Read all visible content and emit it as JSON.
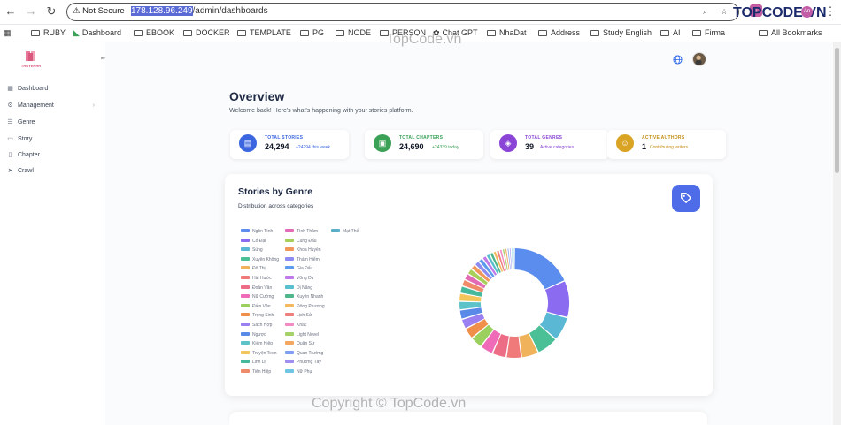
{
  "browser": {
    "security_label": "Not Secure",
    "url_host": "178.128.96.249",
    "url_path": "/admin/dashboards",
    "brand_logo": "TOPCODE.VN",
    "profile_initials": "An",
    "bookmarks": [
      "RUBY",
      "Dashboard",
      "EBOOK",
      "DOCKER",
      "TEMPLATE",
      "PG",
      "NODE",
      "PERSON",
      "Chat GPT",
      "NhaDat",
      "Address",
      "Study English",
      "AI",
      "Firma"
    ],
    "all_bookmarks": "All Bookmarks"
  },
  "sidebar": {
    "brand": "TRUYENHH",
    "items": [
      {
        "label": "Dashboard",
        "icon": "grid-icon"
      },
      {
        "label": "Management",
        "icon": "gear-icon"
      },
      {
        "label": "Genre",
        "icon": "list-icon"
      },
      {
        "label": "Story",
        "icon": "book-icon"
      },
      {
        "label": "Chapter",
        "icon": "document-icon"
      },
      {
        "label": "Crawl",
        "icon": "send-icon"
      }
    ]
  },
  "header": {
    "title": "Overview",
    "subtitle": "Welcome back! Here's what's happening with your stories platform."
  },
  "stats": [
    {
      "label": "TOTAL STORIES",
      "value": "24,294",
      "sub": "+24294 this week",
      "color": "#3b66e0",
      "label_color": "#3b66e0",
      "sub_color": "#3b66e0",
      "icon": "book-icon"
    },
    {
      "label": "TOTAL CHAPTERS",
      "value": "24,690",
      "sub": "+24339 today",
      "color": "#3aa157",
      "label_color": "#3aa157",
      "sub_color": "#3aa157",
      "icon": "document-icon"
    },
    {
      "label": "TOTAL GENRES",
      "value": "39",
      "sub": "Active categories",
      "color": "#8b45d6",
      "label_color": "#8b45d6",
      "sub_color": "#8b45d6",
      "icon": "layers-icon"
    },
    {
      "label": "ACTIVE AUTHORS",
      "value": "1",
      "sub": "Contributing writers",
      "color": "#d9a423",
      "label_color": "#c38d12",
      "sub_color": "#c38d12",
      "icon": "users-icon"
    }
  ],
  "genre_chart": {
    "title": "Stories by Genre",
    "subtitle": "Distribution across categories"
  },
  "chart_data": {
    "type": "pie",
    "title": "Stories by Genre",
    "subtitle": "Distribution across categories",
    "donut": true,
    "legend_position": "left",
    "categories": [
      "Ngôn Tình",
      "Cổ Đại",
      "Sủng",
      "Xuyên Không",
      "Đô Thị",
      "Hài Hước",
      "Đoản Văn",
      "Nữ Cường",
      "Điền Văn",
      "Trọng Sinh",
      "Sách Hợp",
      "Ngược",
      "Kiếm Hiệp",
      "Truyện Teen",
      "Linh Dị",
      "Tiên Hiệp",
      "Tình Thâm",
      "Cung Đấu",
      "Khoa Huyễn",
      "Thám Hiểm",
      "Gia Đấu",
      "Võng Du",
      "Dị Năng",
      "Xuyên Nhanh",
      "Đông Phương",
      "Lịch Sử",
      "Khác",
      "Light Novel",
      "Quân Sự",
      "Quan Trường",
      "Phương Tây",
      "Nữ Phụ",
      "Mạt Thế"
    ],
    "values": [
      3600,
      2150,
      1400,
      1250,
      1000,
      880,
      820,
      760,
      700,
      640,
      580,
      540,
      500,
      460,
      430,
      400,
      370,
      340,
      310,
      290,
      270,
      250,
      230,
      210,
      195,
      180,
      165,
      150,
      135,
      120,
      110,
      100,
      90
    ],
    "colors": [
      "#5b8dee",
      "#8b6cf0",
      "#5ab8d4",
      "#4bbf95",
      "#f0b25a",
      "#f07a7a",
      "#ee6d86",
      "#ef6bb7",
      "#9bd05f",
      "#f08f4a",
      "#9a7ff0",
      "#5a8ae8",
      "#5ec3c8",
      "#f3c55b",
      "#46b89c",
      "#ef8b6b",
      "#e26bb5",
      "#a9cf5b",
      "#f2975c",
      "#8d8af2",
      "#5d9ced",
      "#c07ae8",
      "#58bfcf",
      "#4fb58a",
      "#f4b860",
      "#ee7f7f",
      "#f18cc2",
      "#a5d16a",
      "#f2a861",
      "#7fa0f2",
      "#9f8ef0",
      "#6fc4e4",
      "#5ab0c9"
    ]
  },
  "watermarks": [
    "TopCode.vn",
    "Copyright © TopCode.vn"
  ]
}
